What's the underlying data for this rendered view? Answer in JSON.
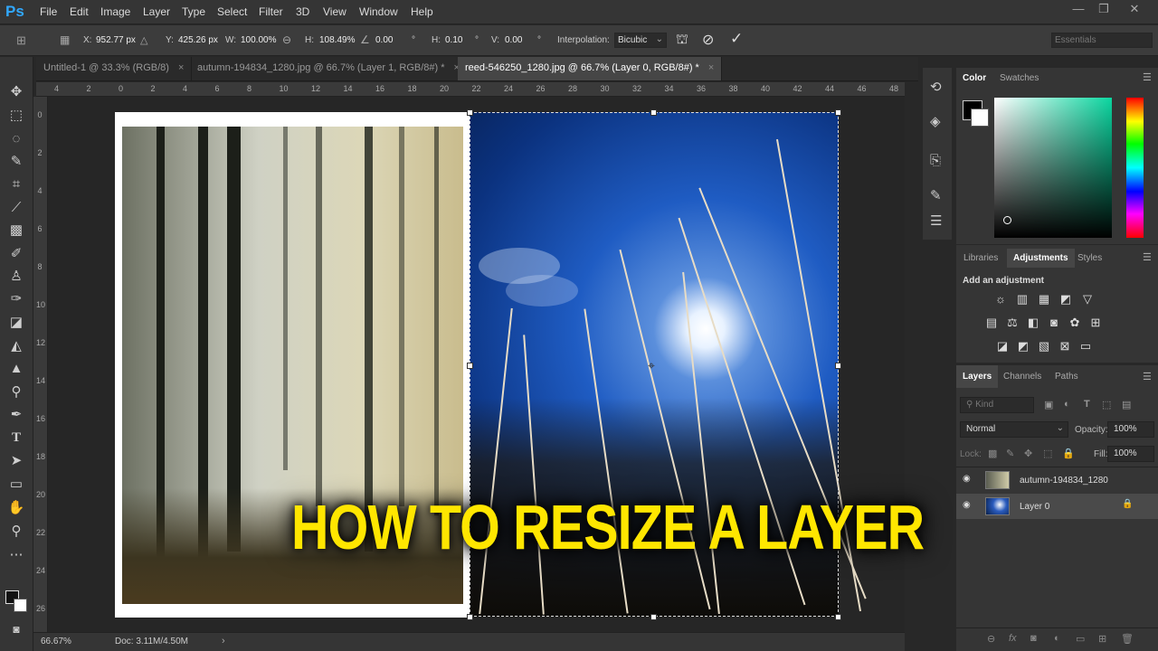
{
  "app": {
    "logo": "Ps"
  },
  "menu": [
    "File",
    "Edit",
    "Image",
    "Layer",
    "Type",
    "Select",
    "Filter",
    "3D",
    "View",
    "Window",
    "Help"
  ],
  "window_controls": [
    "—",
    "❐",
    "✕"
  ],
  "options": {
    "x_label": "X:",
    "x_value": "952.77 px",
    "y_label": "Y:",
    "y_value": "425.26 px",
    "w_label": "W:",
    "w_value": "100.00%",
    "h_label": "H:",
    "h_value": "108.49%",
    "angle_value": "0.00",
    "hskew_label": "H:",
    "hskew_value": "0.10",
    "vskew_label": "V:",
    "vskew_value": "0.00",
    "degree": "°",
    "interp_label": "Interpolation:",
    "interp_value": "Bicubic",
    "workspace": "Essentials"
  },
  "tabs": [
    {
      "label": "Untitled-1 @ 33.3% (RGB/8)",
      "close": "×"
    },
    {
      "label": "autumn-194834_1280.jpg @ 66.7% (Layer 1, RGB/8#) *",
      "close": "×"
    },
    {
      "label": "reed-546250_1280.jpg @ 66.7% (Layer 0, RGB/8#) *",
      "close": "×"
    }
  ],
  "ruler_h": [
    "4",
    "2",
    "0",
    "2",
    "4",
    "6",
    "8",
    "10",
    "12",
    "14",
    "16",
    "18",
    "20",
    "22",
    "24",
    "26",
    "28",
    "30",
    "32",
    "34",
    "36",
    "38",
    "40",
    "42",
    "44",
    "46",
    "48"
  ],
  "ruler_v": [
    "0",
    "2",
    "4",
    "6",
    "8",
    "10",
    "12",
    "14",
    "16",
    "18",
    "20",
    "22",
    "24",
    "26"
  ],
  "headline": "HOW TO RESIZE A LAYER",
  "status": {
    "zoom": "66.67%",
    "doc": "Doc: 3.11M/4.50M"
  },
  "color_panel": {
    "tabs": [
      "Color",
      "Swatches"
    ]
  },
  "adjustments_panel": {
    "tabs": [
      "Libraries",
      "Adjustments",
      "Styles"
    ],
    "heading": "Add an adjustment"
  },
  "layers_panel": {
    "tabs": [
      "Layers",
      "Channels",
      "Paths"
    ],
    "kind_placeholder": "Kind",
    "blend_mode": "Normal",
    "opacity_label": "Opacity:",
    "opacity_value": "100%",
    "lock_label": "Lock:",
    "fill_label": "Fill:",
    "fill_value": "100%",
    "layers": [
      {
        "name": "autumn-194834_1280"
      },
      {
        "name": "Layer 0"
      }
    ]
  },
  "colors": {
    "accent": "#31a8ff",
    "headline": "#ffe600",
    "panel": "#353535"
  }
}
